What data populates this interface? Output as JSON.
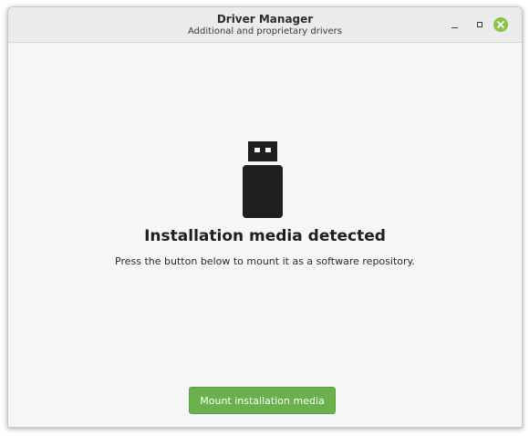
{
  "window": {
    "title": "Driver Manager",
    "subtitle": "Additional and proprietary drivers"
  },
  "titlebar_buttons": {
    "minimize_icon": "minimize-icon",
    "maximize_icon": "maximize-icon",
    "close_icon": "close-icon"
  },
  "main": {
    "icon": "usb-drive-icon",
    "heading": "Installation media detected",
    "description": "Press the button below to mount it as a software repository.",
    "mount_button_label": "Mount installation media"
  },
  "colors": {
    "accent": "#6ab04c",
    "close_button": "#8bc34a"
  }
}
